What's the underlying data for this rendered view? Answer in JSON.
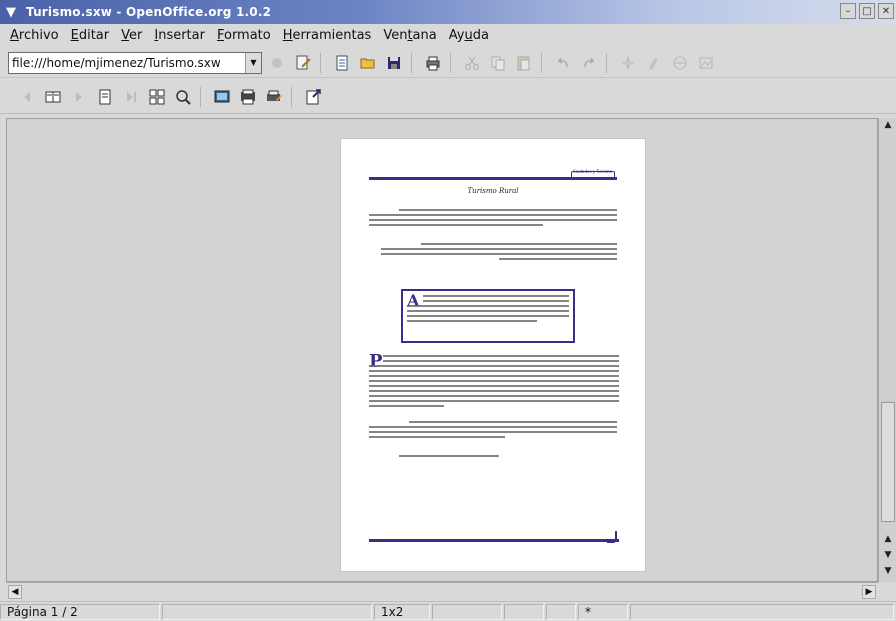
{
  "window": {
    "title": "Turismo.sxw - OpenOffice.org 1.0.2",
    "controls": [
      "minimize",
      "maximize",
      "close"
    ]
  },
  "menubar": {
    "items": [
      {
        "pre": "",
        "key": "A",
        "post": "rchivo"
      },
      {
        "pre": "",
        "key": "E",
        "post": "ditar"
      },
      {
        "pre": "",
        "key": "V",
        "post": "er"
      },
      {
        "pre": "",
        "key": "I",
        "post": "nsertar"
      },
      {
        "pre": "",
        "key": "F",
        "post": "ormato"
      },
      {
        "pre": "",
        "key": "H",
        "post": "erramientas"
      },
      {
        "pre": "Ven",
        "key": "t",
        "post": "ana"
      },
      {
        "pre": "Ay",
        "key": "u",
        "post": "da"
      }
    ]
  },
  "toolbar": {
    "url_value": "file:///home/mjimenez/Turismo.sxw"
  },
  "document": {
    "header_text": "Ciudades y Turismo",
    "page_title": "Turismo Rural",
    "dropcap_a": "A",
    "dropcap_p": "P"
  },
  "statusbar": {
    "page": "Página  1 / 2",
    "zoom": "1x2",
    "insert_marker": "*"
  },
  "colors": {
    "titlebar": "#4a62a8",
    "doc_accent": "#3a2d8a",
    "chrome": "#d9d9d9"
  },
  "icons": [
    "chevron-down-icon",
    "minimize-icon",
    "maximize-icon",
    "close-icon",
    "edit-file-icon",
    "new-document-icon",
    "open-folder-icon",
    "save-disk-icon",
    "print-icon",
    "cut-icon",
    "copy-icon",
    "paste-icon",
    "undo-icon",
    "redo-icon",
    "navigator-icon",
    "gallery-icon",
    "zoom-icon",
    "print-preview-icon"
  ]
}
